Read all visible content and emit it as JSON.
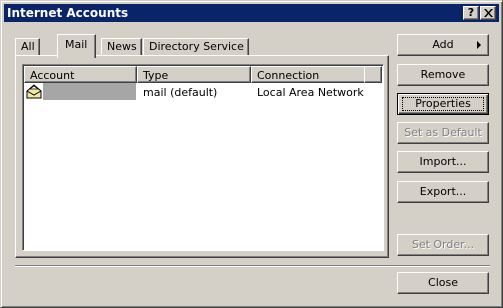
{
  "window": {
    "title": "Internet Accounts",
    "help_glyph": "?"
  },
  "tabs": [
    {
      "label": "All",
      "active": false
    },
    {
      "label": "Mail",
      "active": true
    },
    {
      "label": "News",
      "active": false
    },
    {
      "label": "Directory Service",
      "active": false
    }
  ],
  "list": {
    "columns": [
      "Account",
      "Type",
      "Connection"
    ],
    "rows": [
      {
        "account": "",
        "type": "mail (default)",
        "connection": "Local Area Network",
        "selected": true,
        "icon": "mail-account-icon"
      }
    ]
  },
  "buttons": {
    "add": "Add",
    "remove": "Remove",
    "properties": "Properties",
    "set_default": "Set as Default",
    "import": "Import...",
    "export": "Export...",
    "set_order": "Set Order...",
    "close": "Close"
  },
  "colors": {
    "titlebar": "#0a246a",
    "face": "#d4d0c8",
    "selection": "#a6a6a6"
  }
}
